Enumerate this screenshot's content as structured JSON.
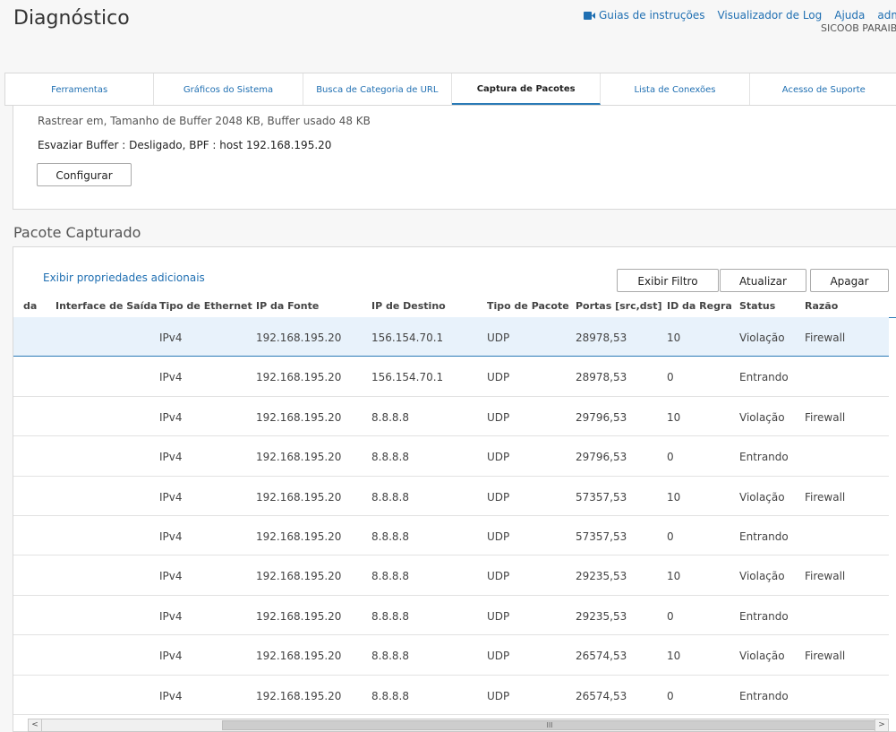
{
  "header": {
    "title": "Diagnóstico",
    "nav": {
      "guides": "Guias de instruções",
      "log_viewer": "Visualizador de Log",
      "help": "Ajuda",
      "user": "admin"
    },
    "org": "SICOOB PARAIBA"
  },
  "tabs": [
    {
      "label": "Ferramentas"
    },
    {
      "label": "Gráficos do Sistema"
    },
    {
      "label": "Busca de Categoria de URL"
    },
    {
      "label": "Captura de Pacotes",
      "active": true
    },
    {
      "label": "Lista de Conexões"
    },
    {
      "label": "Acesso de Suporte"
    }
  ],
  "capture_settings": {
    "trace_line": "Rastrear em, Tamanho de Buffer 2048 KB, Buffer usado 48 KB",
    "buffer_line": "Esvaziar Buffer : Desligado, BPF : host 192.168.195.20",
    "configure_button": "Configurar"
  },
  "captured": {
    "section_title": "Pacote Capturado",
    "show_props_link": "Exibir propriedades adicionais",
    "buttons": {
      "filter": "Exibir Filtro",
      "refresh": "Atualizar",
      "clear": "Apagar"
    },
    "columns": {
      "in_iface_partial": "da",
      "out_iface": "Interface de Saída",
      "eth_type": "Tipo de Ethernet",
      "src_ip": "IP da Fonte",
      "dst_ip": "IP de Destino",
      "pkt_type": "Tipo de Pacote",
      "ports": "Portas [src,dst]",
      "rule_id": "ID da Regra",
      "status": "Status",
      "reason": "Razão"
    },
    "rows": [
      {
        "eth": "IPv4",
        "src": "192.168.195.20",
        "dst": "156.154.70.1",
        "type": "UDP",
        "ports": "28978,53",
        "rule": "10",
        "status": "Violação",
        "reason": "Firewall"
      },
      {
        "eth": "IPv4",
        "src": "192.168.195.20",
        "dst": "156.154.70.1",
        "type": "UDP",
        "ports": "28978,53",
        "rule": "0",
        "status": "Entrando",
        "reason": ""
      },
      {
        "eth": "IPv4",
        "src": "192.168.195.20",
        "dst": "8.8.8.8",
        "type": "UDP",
        "ports": "29796,53",
        "rule": "10",
        "status": "Violação",
        "reason": "Firewall"
      },
      {
        "eth": "IPv4",
        "src": "192.168.195.20",
        "dst": "8.8.8.8",
        "type": "UDP",
        "ports": "29796,53",
        "rule": "0",
        "status": "Entrando",
        "reason": ""
      },
      {
        "eth": "IPv4",
        "src": "192.168.195.20",
        "dst": "8.8.8.8",
        "type": "UDP",
        "ports": "57357,53",
        "rule": "10",
        "status": "Violação",
        "reason": "Firewall"
      },
      {
        "eth": "IPv4",
        "src": "192.168.195.20",
        "dst": "8.8.8.8",
        "type": "UDP",
        "ports": "57357,53",
        "rule": "0",
        "status": "Entrando",
        "reason": ""
      },
      {
        "eth": "IPv4",
        "src": "192.168.195.20",
        "dst": "8.8.8.8",
        "type": "UDP",
        "ports": "29235,53",
        "rule": "10",
        "status": "Violação",
        "reason": "Firewall"
      },
      {
        "eth": "IPv4",
        "src": "192.168.195.20",
        "dst": "8.8.8.8",
        "type": "UDP",
        "ports": "29235,53",
        "rule": "0",
        "status": "Entrando",
        "reason": ""
      },
      {
        "eth": "IPv4",
        "src": "192.168.195.20",
        "dst": "8.8.8.8",
        "type": "UDP",
        "ports": "26574,53",
        "rule": "10",
        "status": "Violação",
        "reason": "Firewall"
      },
      {
        "eth": "IPv4",
        "src": "192.168.195.20",
        "dst": "8.8.8.8",
        "type": "UDP",
        "ports": "26574,53",
        "rule": "0",
        "status": "Entrando",
        "reason": ""
      }
    ],
    "selected_row": 0
  },
  "scrollbar": {
    "left_arrow": "<",
    "right_arrow": ">",
    "grip": "III"
  },
  "colors": {
    "accent": "#2a7ab6",
    "link": "#1f6fb2",
    "selected_row": "#e8f2fb"
  }
}
